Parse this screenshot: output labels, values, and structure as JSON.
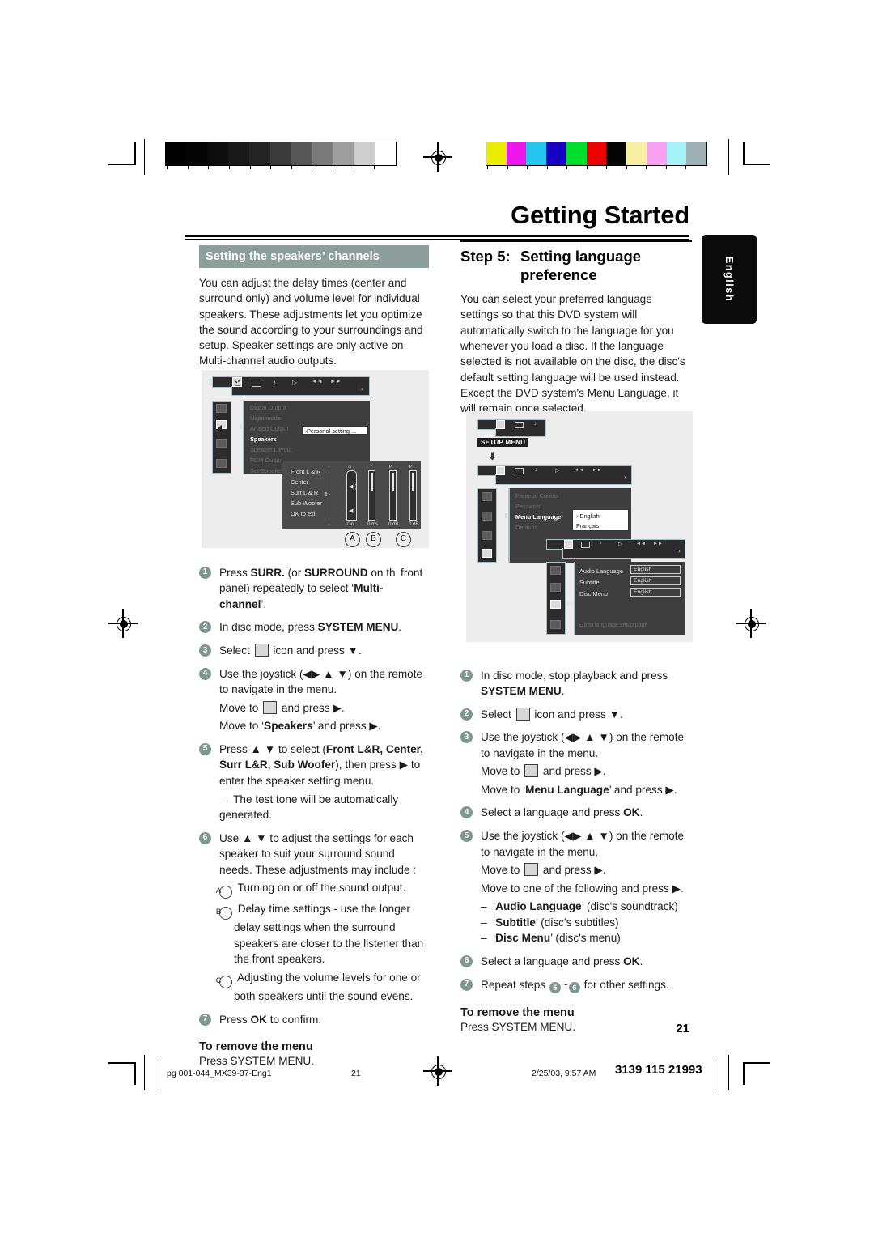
{
  "header": {
    "title": "Getting Started",
    "language_tab": "English"
  },
  "left_column": {
    "section_title": "Setting the speakers’ channels",
    "intro": "You can adjust the delay times (center and surround only) and volume level for individual speakers. These adjustments let you optimize the sound according to your surroundings and setup.  Speaker settings are only active on Multi-channel audio outputs.",
    "steps": [
      {
        "num": "1",
        "html": "Press <b>SURR.</b> (or <b>SURROUND</b> on th  front panel) repeatedly to select ‘<b>Multi-channel</b>’."
      },
      {
        "num": "2",
        "html": "In disc mode, press <b>SYSTEM MENU</b>."
      },
      {
        "num": "3",
        "html": "Select <span class=\"chip sel\" data-name=\"setup-tool-icon\"></span> icon and press ▼."
      },
      {
        "num": "4",
        "html": "Use the joystick (◀▶ ▲ ▼) on the remote to navigate in the menu.<div class=\"sub\">Move to <span class=\"chip sel\" data-name=\"speaker-icon\"></span> and press ▶.</div><div class=\"sub\">Move to ‘<b>Speakers</b>’ and press ▶.</div>"
      },
      {
        "num": "5",
        "html": "Press ▲ ▼ to select (<b>Front L&amp;R, Center, Surr L&amp;R, Sub Woofer</b>), then press ▶ to enter the speaker setting menu.<div class=\"sub\"><span class=\"ar\">→</span> The test tone will be automatically generated.</div>"
      },
      {
        "num": "6",
        "html": "Use ▲ ▼ to adjust the settings for each speaker to suit your surround sound needs. These adjustments may include :<div class=\"sub hang\"><span class=\"alpha\">A</span> Turning on or off the sound output.</div><div class=\"sub hang\"><span class=\"alpha\">B</span> Delay time settings - use the longer delay settings when the surround speakers are closer to the listener than the front speakers.</div><div class=\"sub hang\"><span class=\"alpha\">C</span> Adjusting the volume levels for one or both speakers until the sound evens.</div>"
      },
      {
        "num": "7",
        "html": "Press <b>OK</b> to confirm."
      }
    ],
    "remove_menu_heading": "To remove the menu",
    "remove_menu_text": "Press SYSTEM MENU.",
    "figure": {
      "menu_items": [
        "Digital Output",
        "Night mode",
        "Analog Output",
        "Speakers",
        "Speaker Layout",
        "PCM Output",
        "Set  Speaker"
      ],
      "selected_item": "Speakers",
      "popup": "Personal setting ...",
      "speaker_rows": [
        "Front L & R",
        "Center",
        "Surr L & R",
        "Sub Woofer",
        "OK to exit"
      ],
      "column_values": [
        "On",
        "0 ms",
        "0 dB",
        "0 dB"
      ],
      "callouts": [
        "A",
        "B",
        "C"
      ]
    }
  },
  "right_column": {
    "step_label": "Step 5:",
    "step_title": "Setting language preference",
    "intro": "You can select your preferred language settings so that this DVD system will automatically switch to the language for you whenever you load a disc.  If the language selected is not available on the disc, the disc's default setting language will be used instead.  Except the DVD system's Menu Language, it will remain once selected.",
    "steps": [
      {
        "num": "1",
        "html": "In disc mode, stop playback and press <b>SYSTEM MENU</b>."
      },
      {
        "num": "2",
        "html": "Select <span class=\"chip sel\" data-name=\"setup-tool-icon\"></span> icon and press ▼."
      },
      {
        "num": "3",
        "html": "Use the joystick (◀▶ ▲ ▼) on the remote to navigate in the menu.<div class=\"sub\">Move to <span class=\"chip sel\" data-name=\"preferences-icon\"></span> and press ▶.</div><div class=\"sub\">Move to ‘<b>Menu Language</b>’ and press ▶.</div>"
      },
      {
        "num": "4",
        "html": "Select a language and press <b>OK</b>."
      },
      {
        "num": "5",
        "html": "Use the joystick (◀▶ ▲ ▼) on the remote to navigate in the menu.<div class=\"sub\">Move to <span class=\"chip sel\" data-name=\"subtitle-icon\"></span> and press ▶.</div><div class=\"sub\">Move to one of the following and press ▶.</div><div class=\"sub dash\">–&nbsp; ‘<b>Audio Language</b>’ (disc's soundtrack)</div><div class=\"dash\">–&nbsp; ‘<b>Subtitle</b>’ (disc's subtitles)</div><div class=\"dash\">–&nbsp; ‘<b>Disc Menu</b>’ (disc's menu)</div>"
      },
      {
        "num": "6",
        "html": "Select a language and press <b>OK</b>."
      },
      {
        "num": "7",
        "html": "Repeat steps <span class=\"numi\">5</span>~<span class=\"numi\">6</span> for other settings."
      }
    ],
    "remove_menu_heading": "To remove the menu",
    "remove_menu_text": "Press SYSTEM MENU.",
    "figure": {
      "setup_menu_label": "SETUP MENU",
      "menu_items": [
        "Parental Control",
        "Password",
        "Menu Language",
        "Defaults"
      ],
      "selected_item": "Menu Language",
      "language_options": [
        "English",
        "Français"
      ],
      "sub_rows": [
        {
          "label": "Audio Language",
          "value": "English"
        },
        {
          "label": "Subtitle",
          "value": "English"
        },
        {
          "label": "Disc Menu",
          "value": "English"
        }
      ],
      "footer_hint": "Go to language setup page"
    }
  },
  "page_number": "21",
  "footer": {
    "file": "pg 001-044_MX39-37-Eng1",
    "page": "21",
    "timestamp": "2/25/03, 9:57 AM",
    "code": "3139 115 21993"
  },
  "colorbars": {
    "gray": [
      "#000000",
      "#050505",
      "#0d0d0d",
      "#181818",
      "#242424",
      "#3a3a3a",
      "#565656",
      "#7a7a7a",
      "#9e9e9e",
      "#cfcfcf",
      "#ffffff"
    ],
    "color": [
      "#ecec00",
      "#ee18ee",
      "#24c7f0",
      "#1600c4",
      "#00de2c",
      "#ee0000",
      "#050505",
      "#f6f0a0",
      "#f9a0f3",
      "#a5f2fa",
      "#9fb1b3"
    ]
  },
  "accent": "#8d9f9c"
}
